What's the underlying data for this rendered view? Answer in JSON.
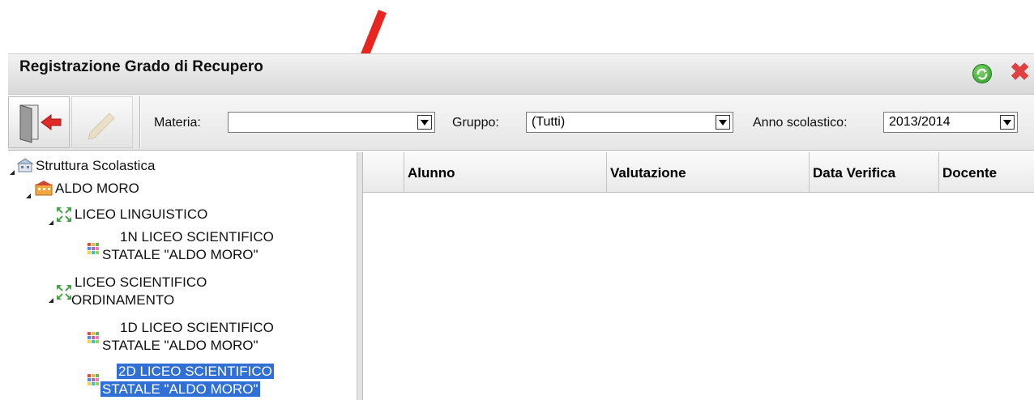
{
  "window": {
    "title": "Registrazione Grado di Recupero",
    "refresh_icon": "refresh-icon",
    "close_icon": "close-icon"
  },
  "toolbar": {
    "exit_icon": "exit-door-icon",
    "edit_icon": "pencil-icon",
    "materia_label": "Materia:",
    "materia_value": "",
    "gruppo_label": "Gruppo:",
    "gruppo_value": "(Tutti)",
    "anno_label": "Anno scolastico:",
    "anno_value": "2013/2014"
  },
  "tree": {
    "root": "Struttura Scolastica",
    "school": "ALDO MORO",
    "branches": [
      {
        "line1": "LICEO LINGUISTICO",
        "line2": "",
        "classes": [
          {
            "line1": "1N LICEO SCIENTIFICO",
            "line2": "STATALE \"ALDO MORO\"",
            "selected": false
          }
        ]
      },
      {
        "line1": "LICEO SCIENTIFICO",
        "line2": "ORDINAMENTO",
        "classes": [
          {
            "line1": "1D LICEO SCIENTIFICO",
            "line2": "STATALE \"ALDO MORO\"",
            "selected": false
          },
          {
            "line1": "2D LICEO SCIENTIFICO",
            "line2": "STATALE \"ALDO MORO\"",
            "selected": true
          }
        ]
      }
    ]
  },
  "grid": {
    "columns": [
      "Alunno",
      "Valutazione",
      "Data Verifica",
      "Docente"
    ],
    "rows": []
  },
  "colors": {
    "annotation_arrow": "#e8251f",
    "selection": "#2f6fd6"
  }
}
